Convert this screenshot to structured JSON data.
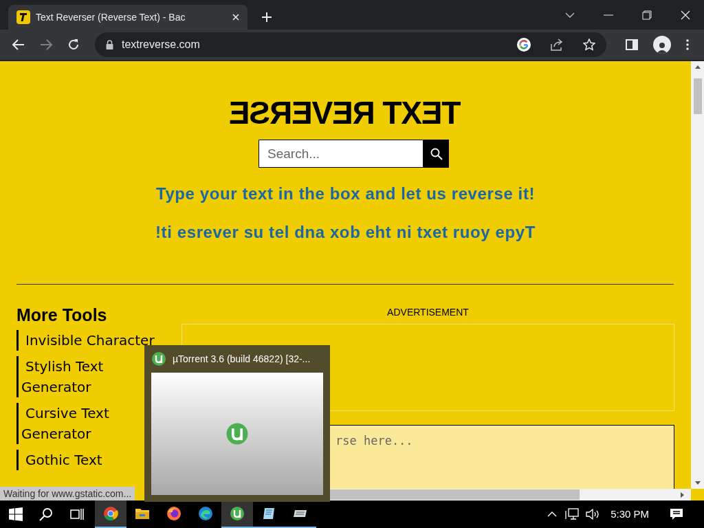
{
  "browser": {
    "tab_title": "Text Reverser (Reverse Text) - Bac",
    "url": "textreverse.com"
  },
  "page": {
    "logo": "TEXT REVERSE",
    "search_placeholder": "Search...",
    "headline": "Type your text in the box and let us reverse it!",
    "headline_reversed": "!ti esrever su tel dna xob eht ni txet ruoy epyT",
    "more_tools_title": "More Tools",
    "tools": [
      {
        "lines": [
          "Invisible Character"
        ]
      },
      {
        "lines": [
          "Stylish Text",
          "Generator"
        ]
      },
      {
        "lines": [
          "Cursive Text",
          "Generator"
        ]
      },
      {
        "lines": [
          "Gothic Text"
        ]
      }
    ],
    "ad_label": "ADVERTISEMENT",
    "textarea_placeholder": "rse here..."
  },
  "status_text": "Waiting for www.gstatic.com...",
  "preview": {
    "title": "µTorrent 3.6  (build 46822) [32-..."
  },
  "taskbar": {
    "apps": [
      {
        "kind": "chrome",
        "running": true,
        "selected": true
      },
      {
        "kind": "folder",
        "running": false,
        "selected": false
      },
      {
        "kind": "firefox",
        "running": false,
        "selected": false
      },
      {
        "kind": "edge",
        "running": false,
        "selected": false
      },
      {
        "kind": "utorrent",
        "running": true,
        "selected": true
      },
      {
        "kind": "notepad",
        "running": true,
        "selected": false
      },
      {
        "kind": "keyboard",
        "running": true,
        "selected": false
      }
    ],
    "clock": "5:30 PM"
  }
}
